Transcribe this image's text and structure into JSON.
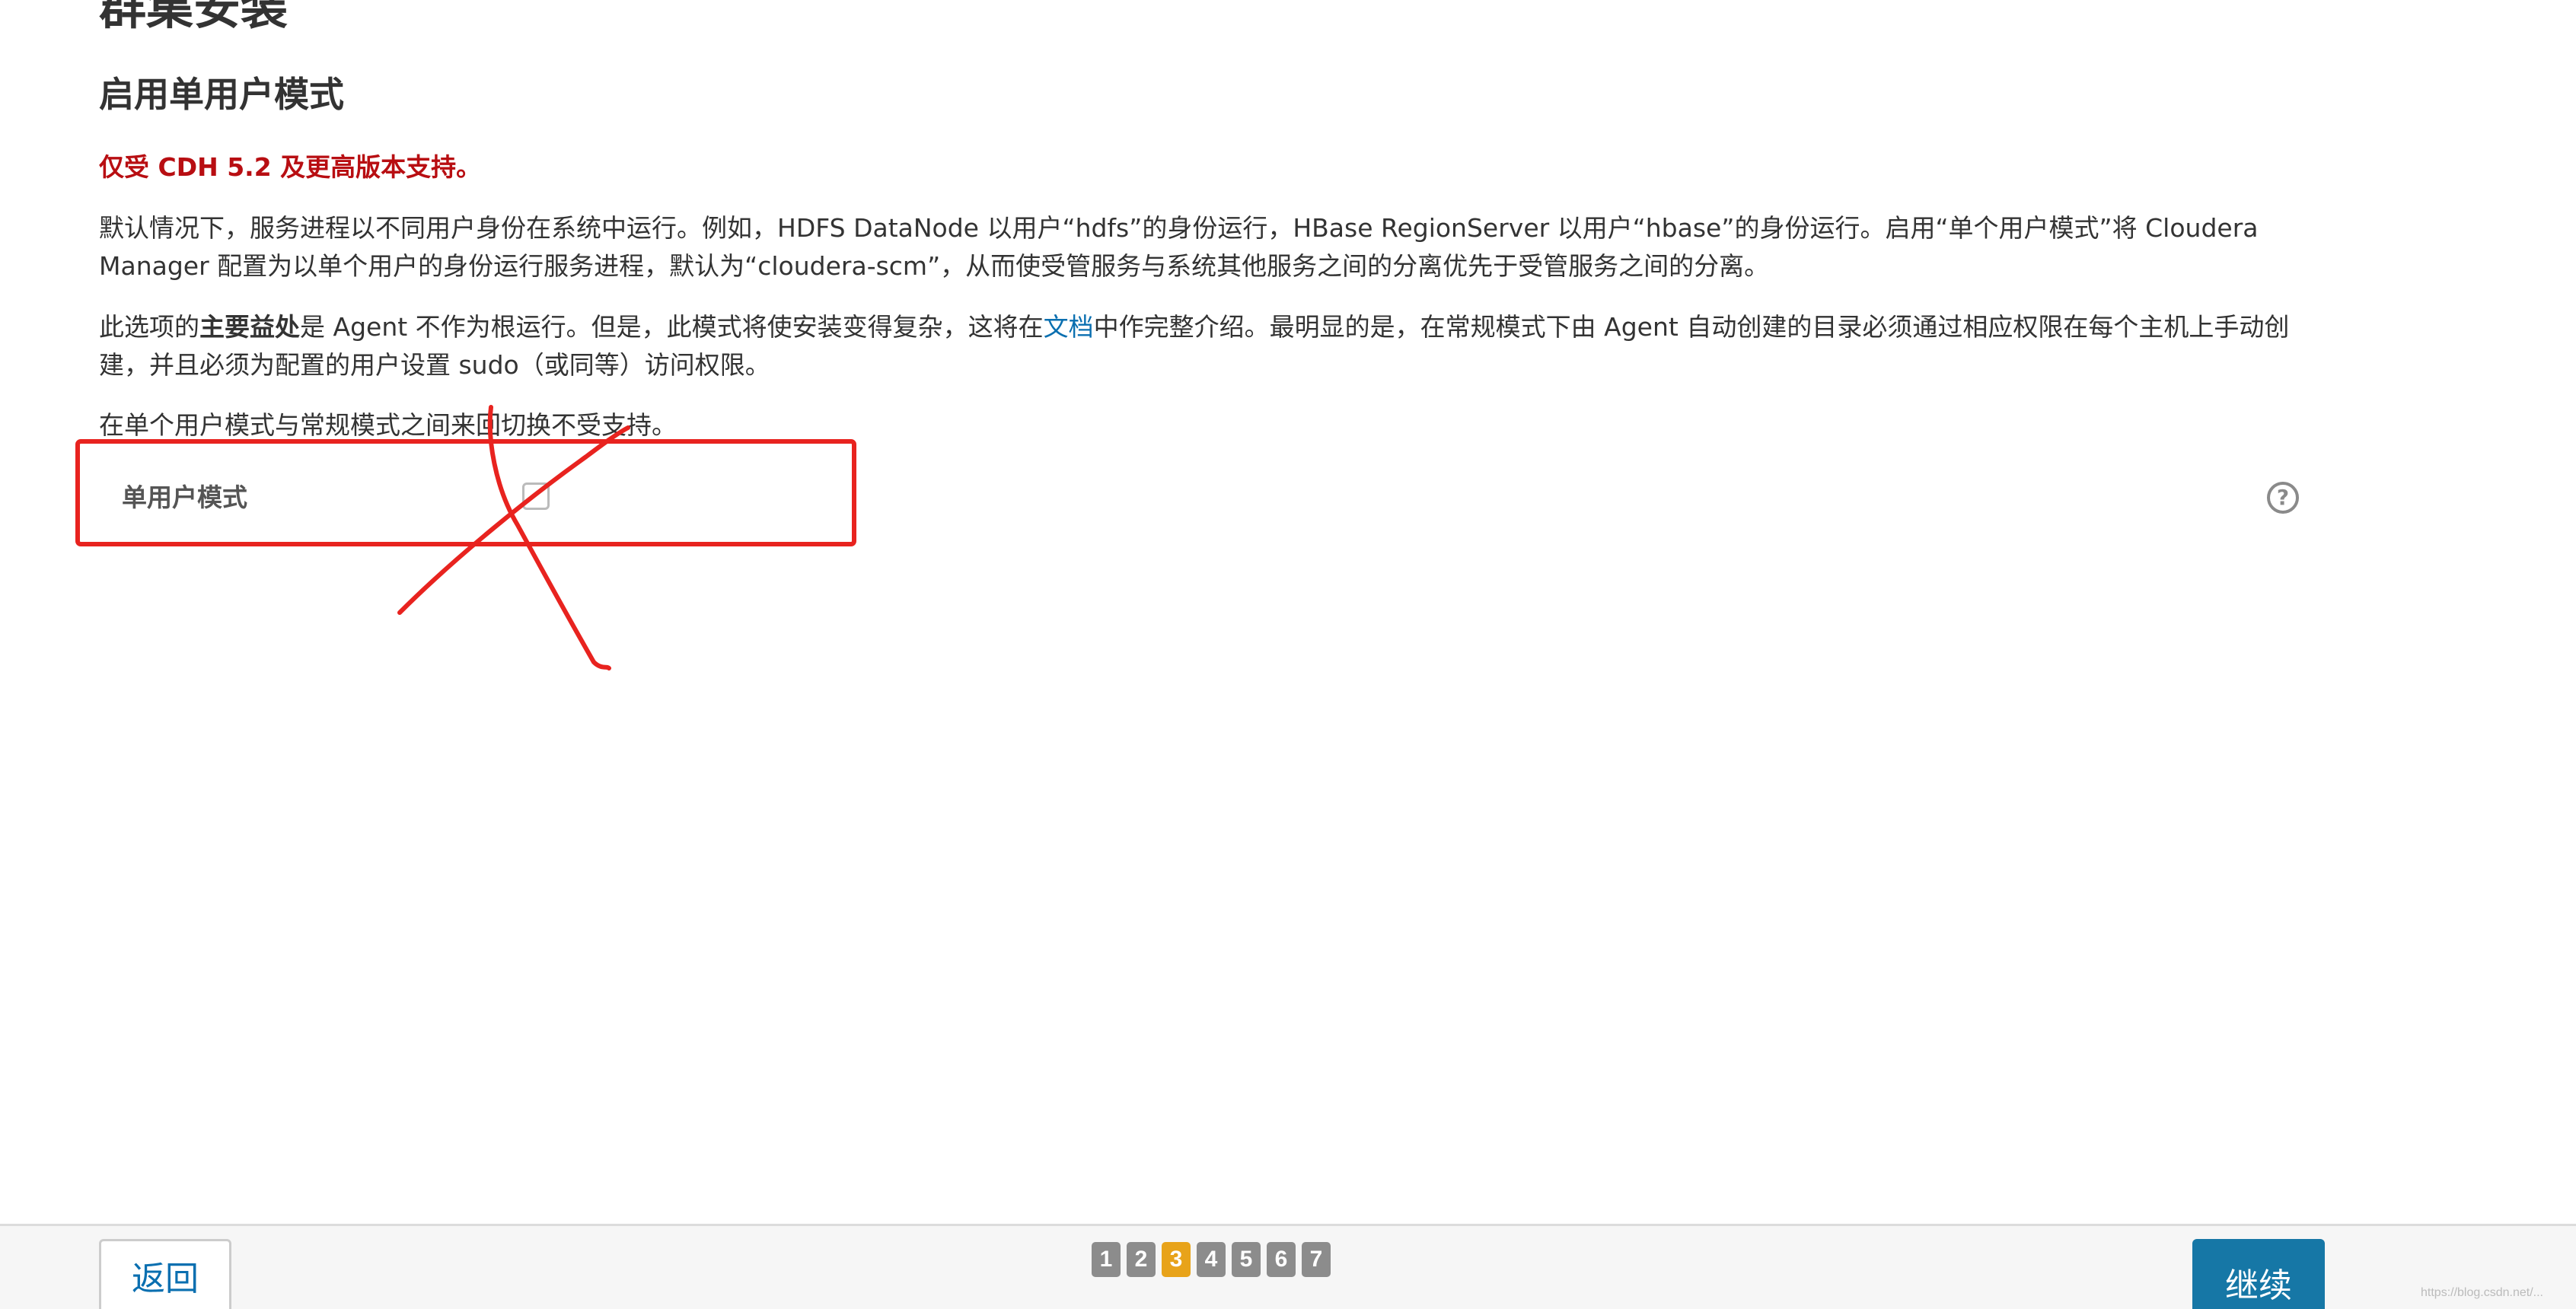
{
  "page": {
    "title": "群集安装",
    "section_title": "启用单用户模式",
    "warning": "仅受 CDH 5.2 及更高版本支持。"
  },
  "paragraphs": {
    "p1": "默认情况下，服务进程以不同用户身份在系统中运行。例如，HDFS DataNode 以用户“hdfs”的身份运行，HBase RegionServer 以用户“hbase”的身份运行。启用“单个用户模式”将 Cloudera Manager 配置为以单个用户的身份运行服务进程，默认为“cloudera-scm”，从而使受管服务与系统其他服务之间的分离优先于受管服务之间的分离。",
    "p2_before": "此选项的",
    "p2_bold": "主要益处",
    "p2_middle": "是 Agent 不作为根运行。但是，此模式将使安装变得复杂，这将在",
    "p2_link": "文档",
    "p2_after": "中作完整介绍。最明显的是，在常规模式下由 Agent 自动创建的目录必须通过相应权限在每个主机上手动创建，并且必须为配置的用户设置 sudo（或同等）访问权限。",
    "p3": "在单个用户模式与常规模式之间来回切换不受支持。"
  },
  "setting": {
    "label": "单用户模式",
    "checked": false,
    "help_glyph": "?"
  },
  "annotation": {
    "color": "#e8231f"
  },
  "footer": {
    "back_label": "返回",
    "continue_label": "继续",
    "steps": [
      "1",
      "2",
      "3",
      "4",
      "5",
      "6",
      "7"
    ],
    "active_step": "3",
    "watermark": "https://blog.csdn.net/..."
  },
  "colors": {
    "warning": "#b80e12",
    "link": "#0a6fb0",
    "primary_button": "#1677a6",
    "active_step": "#e8a31a",
    "step": "#8c8c8c"
  }
}
